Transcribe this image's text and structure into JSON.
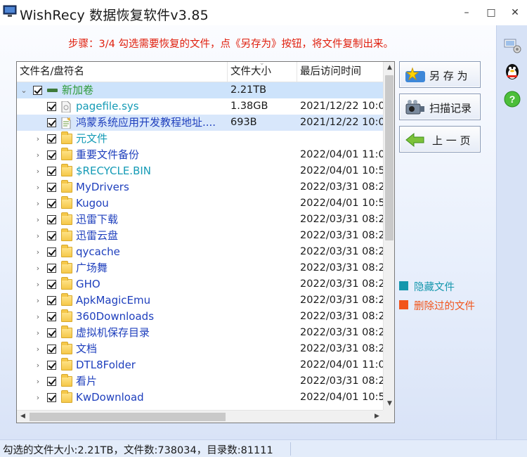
{
  "window": {
    "title": "WishRecy 数据恢复软件v3.85",
    "min_glyph": "–",
    "max_glyph": "□",
    "close_glyph": "✕"
  },
  "step_text": "步骤：3/4 勾选需要恢复的文件，点《另存为》按钮，将文件复制出来。",
  "table": {
    "headers": [
      "文件名/盘符名",
      "文件大小",
      "最后访问时间"
    ],
    "rows": [
      {
        "name": "新加卷",
        "size": "2.21TB",
        "date": "",
        "kind": "drive",
        "color": "#2e9a39"
      },
      {
        "name": "pagefile.sys",
        "size": "1.38GB",
        "date": "2021/12/22 10:0",
        "kind": "sys",
        "color": "#159bb6"
      },
      {
        "name": "鸿蒙系统应用开发教程地址....",
        "size": "693B",
        "date": "2021/12/22 10:0",
        "kind": "txt",
        "color": "#1e3fbd"
      },
      {
        "name": "元文件",
        "size": "",
        "date": "",
        "kind": "folder",
        "color": "#159bb6"
      },
      {
        "name": "重要文件备份",
        "size": "",
        "date": "2022/04/01 11:0",
        "kind": "folder",
        "color": "#1e3fbd"
      },
      {
        "name": "$RECYCLE.BIN",
        "size": "",
        "date": "2022/04/01 10:5",
        "kind": "folder",
        "color": "#159bb6"
      },
      {
        "name": "MyDrivers",
        "size": "",
        "date": "2022/03/31 08:2",
        "kind": "folder",
        "color": "#1e3fbd"
      },
      {
        "name": "Kugou",
        "size": "",
        "date": "2022/04/01 10:5",
        "kind": "folder",
        "color": "#1e3fbd"
      },
      {
        "name": "迅雷下载",
        "size": "",
        "date": "2022/03/31 08:2",
        "kind": "folder",
        "color": "#1e3fbd"
      },
      {
        "name": "迅雷云盘",
        "size": "",
        "date": "2022/03/31 08:2",
        "kind": "folder",
        "color": "#1e3fbd"
      },
      {
        "name": "qycache",
        "size": "",
        "date": "2022/03/31 08:2",
        "kind": "folder",
        "color": "#1e3fbd"
      },
      {
        "name": "广场舞",
        "size": "",
        "date": "2022/03/31 08:2",
        "kind": "folder",
        "color": "#1e3fbd"
      },
      {
        "name": "GHO",
        "size": "",
        "date": "2022/03/31 08:2",
        "kind": "folder",
        "color": "#1e3fbd"
      },
      {
        "name": "ApkMagicEmu",
        "size": "",
        "date": "2022/03/31 08:2",
        "kind": "folder",
        "color": "#1e3fbd"
      },
      {
        "name": "360Downloads",
        "size": "",
        "date": "2022/03/31 08:2",
        "kind": "folder",
        "color": "#1e3fbd"
      },
      {
        "name": "虚拟机保存目录",
        "size": "",
        "date": "2022/03/31 08:2",
        "kind": "folder",
        "color": "#1e3fbd"
      },
      {
        "name": "文档",
        "size": "",
        "date": "2022/03/31 08:2",
        "kind": "folder",
        "color": "#1e3fbd"
      },
      {
        "name": "DTL8Folder",
        "size": "",
        "date": "2022/04/01 11:0",
        "kind": "folder",
        "color": "#1e3fbd"
      },
      {
        "name": "看片",
        "size": "",
        "date": "2022/03/31 08:2",
        "kind": "folder",
        "color": "#1e3fbd"
      },
      {
        "name": "KwDownload",
        "size": "",
        "date": "2022/04/01 10:5",
        "kind": "folder",
        "color": "#1e3fbd"
      }
    ]
  },
  "buttons": {
    "save_as": "另 存 为",
    "scan_record": "扫描记录",
    "prev_page": "上 一 页"
  },
  "legend": [
    {
      "label": "隐藏文件",
      "color": "#1597ad"
    },
    {
      "label": "删除过的文件",
      "color": "#f2541b"
    }
  ],
  "status": "勾选的文件大小:2.21TB，文件数:738034，目录数:81111"
}
